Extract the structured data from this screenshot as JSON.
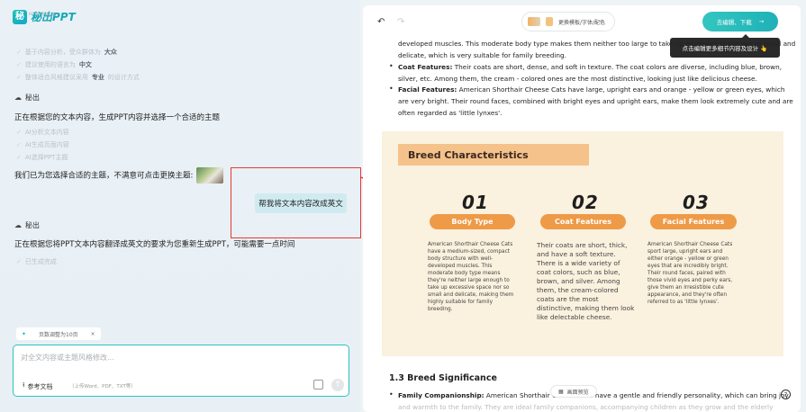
{
  "app": {
    "logo_mark": "秘",
    "logo_text": "秘出PPT",
    "logo_sub": "AI PPT 智能生成"
  },
  "left": {
    "requirements": [
      {
        "prefix": "基于内容分析，受众群体为 ",
        "bold": "大众"
      },
      {
        "prefix": "建议使用的语言为 ",
        "bold": "中文"
      },
      {
        "prefix": "整体适合风格建议采用 ",
        "bold": "专业",
        "suffix": " 的设计方式"
      }
    ],
    "bot1_label": "秘出",
    "bot1_msg": "正在根据您的文本内容，生成PPT内容并选择一个合适的主题",
    "steps1": [
      "AI分析文本内容",
      "AI生成页面内容",
      "AI选择PPT主题"
    ],
    "theme_msg": "我们已为您选择合适的主题，不满意可点击更换主题:",
    "user_msg": "帮我将文本内容改成英文",
    "bot2_label": "秘出",
    "bot2_msg": "正在根据您将PPT文本内容翻译成英文的要求为您重新生成PPT，可能需要一点时间",
    "steps2": [
      "已生成完成"
    ],
    "tag_chip": "页数调整为10页",
    "tag_close": "×",
    "input_placeholder": "对全文内容或主题风格修改...",
    "ref_label": "参考文档",
    "ref_hint": "（上传Word、PDF、TXT等）",
    "send_glyph": "↑"
  },
  "toolbar": {
    "undo": "↶",
    "redo": "↷",
    "template_label": "更换模板/字体/配色",
    "edit_label": "去编辑、下载",
    "edit_arrow": "→",
    "tooltip": "点击编辑更多细节内容及设计 👆"
  },
  "doc": {
    "para0_line1": "developed muscles. This moderate body type makes them neither too large to take up excessive space nor so small and",
    "para0_line2": "delicate, which is very suitable for family breeding.",
    "coat_label": "Coat Features:",
    "coat_text_line1": " Their coats are short, dense, and soft in texture. The coat colors are diverse, including blue, brown,",
    "coat_text_line2": "silver, etc. Among them, the cream - colored ones are the most distinctive, looking just like delicious cheese.",
    "facial_label": "Facial Features:",
    "facial_text_line1": " American Shorthair Cheese Cats have large, upright ears and orange - yellow or green eyes, which",
    "facial_text_line2": "are very bright. Their round faces, combined with bright eyes and upright ears, make them look extremely cute and are",
    "facial_text_line3": "often regarded as 'little lynxes'.",
    "section_title": "1.3 Breed Significance",
    "family_label": "Family Companionship:",
    "family_text": " American Shorthair Cheese Cats have a gentle and friendly personality, which can bring joy",
    "family_text_line2": "and warmth to the family. They are ideal family companions, accompanying children as they grow and the elderly"
  },
  "slide": {
    "title": "Breed Characteristics",
    "columns": [
      {
        "num": "01",
        "pill": "Body Type",
        "body": "American Shorthair Cheese Cats have a medium-sized, compact body structure with well-developed muscles. This moderate body type means they're neither large enough to take up excessive space nor so small and delicate, making them highly suitable for family breeding."
      },
      {
        "num": "02",
        "pill": "Coat Features",
        "body": "Their coats are short, thick, and have a soft texture. There is a wide variety of coat colors, such as blue, brown, and silver. Among them, the cream-colored coats are the most distinctive, making them look like delectable cheese."
      },
      {
        "num": "03",
        "pill": "Facial Features",
        "body": "American Shorthair Cheese Cats sport large, upright ears and either orange - yellow or green eyes that are incredibly bright. Their round faces, paired with those vivid eyes and perky ears, give them an irresistible cute appearance, and they're often referred to as 'little lynxes'."
      }
    ]
  },
  "preview_label": "画面预览",
  "help_glyph": "?",
  "colors": {
    "accent": "#1fb1b7",
    "slide_orange": "#ef9a47",
    "slide_bg": "#fbf1df",
    "annotation_red": "#e53935"
  }
}
